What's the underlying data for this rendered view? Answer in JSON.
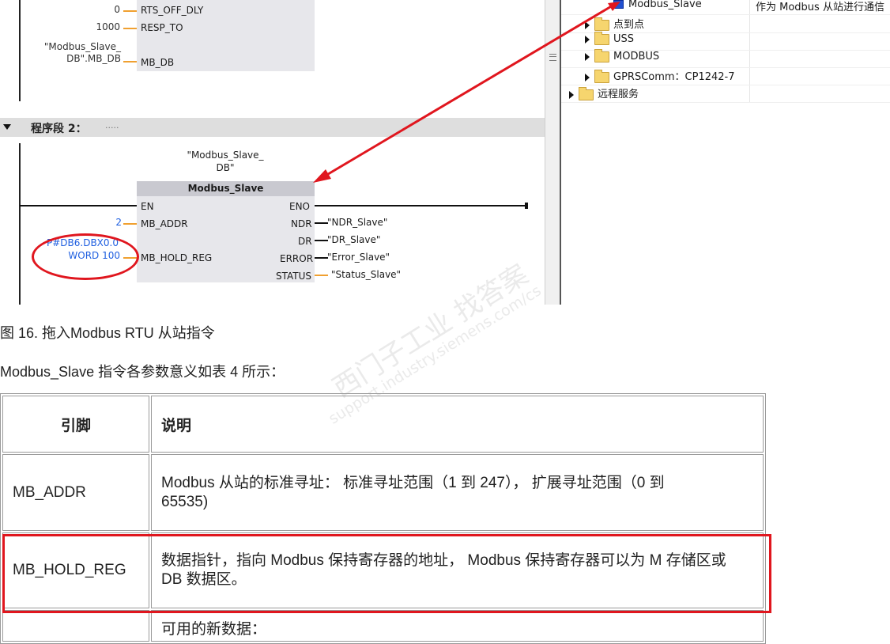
{
  "editor": {
    "upper_block": {
      "pins": [
        "RTS_OFF_DLY",
        "RESP_TO",
        "MB_DB"
      ],
      "params": [
        "0",
        "1000",
        "\"Modbus_Slave_\nDB\".MB_DB"
      ]
    },
    "segment": {
      "label": "程序段 2：",
      "comment": "....."
    },
    "block": {
      "instance": "\"Modbus_Slave_\nDB\"",
      "title": "Modbus_Slave",
      "en": "EN",
      "eno": "ENO",
      "inputs": [
        "MB_ADDR",
        "MB_HOLD_REG"
      ],
      "outputs": [
        "NDR",
        "DR",
        "ERROR",
        "STATUS"
      ],
      "addr_value": "2",
      "hold_reg_value_line1": "P#DB6.DBX0.0",
      "hold_reg_value_line2": "WORD 100",
      "output_operands": [
        "\"NDR_Slave\"",
        "\"DR_Slave\"",
        "\"Error_Slave\"",
        "\"Status_Slave\""
      ]
    }
  },
  "instruction_tree": {
    "items": [
      {
        "label": "Modbus_Slave",
        "description": "作为 Modbus 从站进行通信",
        "kind": "instruction"
      },
      {
        "label": "点到点",
        "kind": "folder"
      },
      {
        "label": "USS",
        "kind": "folder"
      },
      {
        "label": "MODBUS",
        "kind": "folder"
      },
      {
        "label": "GPRSComm：CP1242-7",
        "kind": "folder"
      },
      {
        "label": "远程服务",
        "kind": "folder"
      }
    ]
  },
  "document": {
    "figure_caption": "图 16. 拖入Modbus RTU 从站指令",
    "intro": "Modbus_Slave 指令各参数意义如表 4 所示：",
    "table": {
      "headers": [
        "引脚",
        "说明"
      ],
      "rows": [
        {
          "pin": "MB_ADDR",
          "desc": "Modbus 从站的标准寻址： 标准寻址范围（1 到 247）， 扩展寻址范围（0 到\n65535)"
        },
        {
          "pin": "MB_HOLD_REG",
          "desc": "数据指针，指向 Modbus 保持寄存器的地址， Modbus 保持寄存器可以为 M 存储区或\nDB 数据区。"
        },
        {
          "pin": "",
          "desc": "可用的新数据："
        }
      ]
    }
  },
  "watermark": {
    "line1": "西门子工业  找答案",
    "line2": "support.industry.siemens.com/cs"
  },
  "colors": {
    "highlight_red": "#e0161e",
    "wire_orange": "#f0a030",
    "param_blue": "#1f5fe0"
  }
}
